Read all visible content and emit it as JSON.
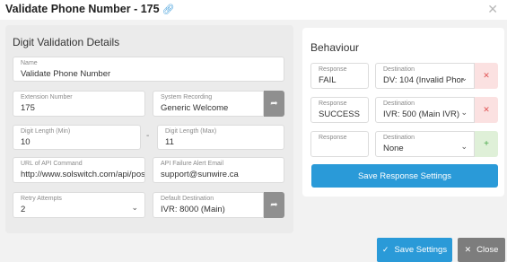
{
  "header": {
    "title": "Validate Phone Number - 175",
    "link_icon": "link-icon",
    "close_icon": "close-icon"
  },
  "digit_validation": {
    "title": "Digit Validation Details",
    "name": {
      "label": "Name",
      "value": "Validate Phone Number"
    },
    "extension_number": {
      "label": "Extension Number",
      "value": "175"
    },
    "system_recording": {
      "label": "System Recording",
      "value": "Generic Welcome"
    },
    "digit_length_min": {
      "label": "Digit Length (Min)",
      "value": "10"
    },
    "digit_length_separator": "-",
    "digit_length_max": {
      "label": "Digit Length (Max)",
      "value": "11"
    },
    "api_url": {
      "label": "URL of API Command",
      "value": "http://www.solswitch.com/api/pos"
    },
    "api_failure_email": {
      "label": "API Failure Alert Email",
      "value": "support@sunwire.ca"
    },
    "retry_attempts": {
      "label": "Retry Attempts",
      "value": "2"
    },
    "default_destination": {
      "label": "Default Destination",
      "value": "IVR: 8000 (Main)"
    }
  },
  "behaviour": {
    "title": "Behaviour",
    "rows": [
      {
        "response_label": "Response",
        "response_value": "FAIL",
        "destination_label": "Destination",
        "destination_value": "DV: 104 (Invalid Phor",
        "action": "remove"
      },
      {
        "response_label": "Response",
        "response_value": "SUCCESS",
        "destination_label": "Destination",
        "destination_value": "IVR: 500 (Main IVR)",
        "action": "remove"
      },
      {
        "response_label": "Response",
        "response_value": "",
        "destination_label": "Destination",
        "destination_value": "None",
        "action": "add"
      }
    ],
    "save_label": "Save Response Settings"
  },
  "footer": {
    "save_label": "Save Settings",
    "close_label": "Close"
  },
  "colors": {
    "primary": "#2a9ad8",
    "remove_bg": "#fbe1e1",
    "add_bg": "#dff0d8",
    "close_bg": "#7d7d7d"
  }
}
